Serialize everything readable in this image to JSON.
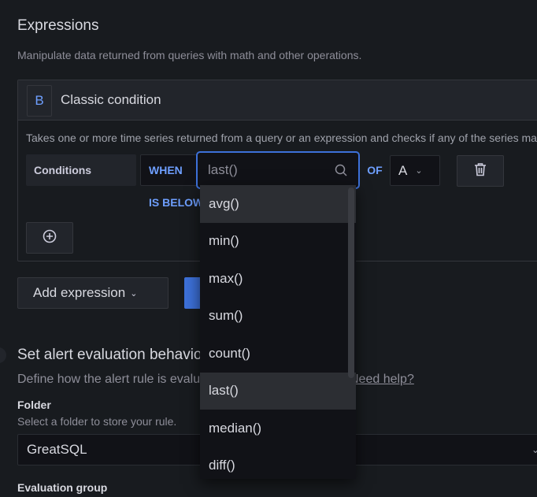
{
  "expressions": {
    "title": "Expressions",
    "subtitle": "Manipulate data returned from queries with math and other operations."
  },
  "expression": {
    "ref_id": "B",
    "type_title": "Classic condition",
    "description": "Takes one or more time series returned from a query or an expression and checks if any of the series match the condition.",
    "conditions_label": "Conditions",
    "when_label": "WHEN",
    "reducer_value": "last()",
    "of_label": "OF",
    "query_ref": "A",
    "evaluator_label": "IS BELOW"
  },
  "reducer_dropdown": {
    "options": [
      "avg()",
      "min()",
      "max()",
      "sum()",
      "count()",
      "last()",
      "median()",
      "diff()"
    ],
    "hovered": "avg()",
    "selected": "last()"
  },
  "buttons": {
    "add_expression": "Add expression",
    "add_condition_icon": "plus-circle-icon",
    "delete_icon": "trash-icon"
  },
  "evaluation": {
    "section_title": "Set alert evaluation behavior",
    "section_subtitle": "Define how the alert rule is evaluated.",
    "help_link": "Need help?",
    "folder_label": "Folder",
    "folder_desc": "Select a folder to store your rule.",
    "folder_value": "GreatSQL",
    "evaluation_group_label": "Evaluation group"
  },
  "colors": {
    "accent": "#6e9fff",
    "primary_button": "#3d71d9",
    "background": "#181b1f",
    "panel_header": "#22252b"
  }
}
